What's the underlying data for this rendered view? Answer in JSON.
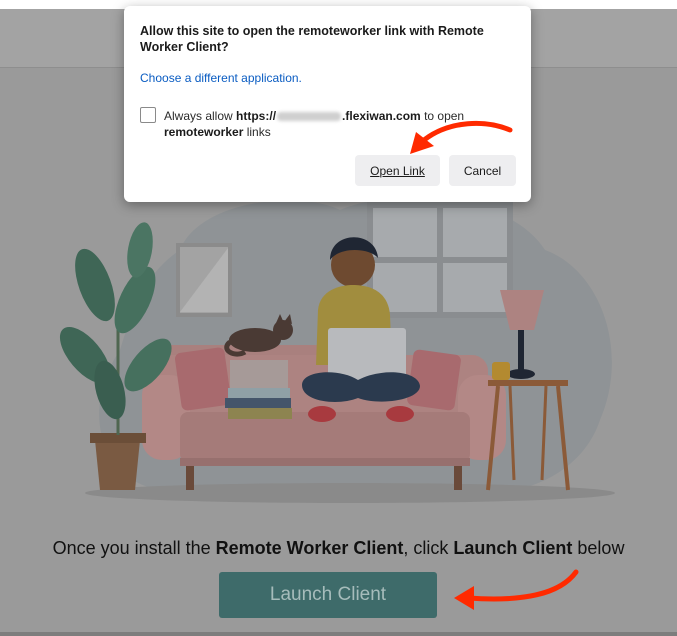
{
  "dialog": {
    "title": "Allow this site to open the remoteworker link with Remote Worker Client?",
    "choose_link": "Choose a different application.",
    "always_prefix": "Always allow ",
    "always_domain_start": "https://",
    "always_domain_end": ".flexiwan.com",
    "always_middle": " to open ",
    "always_scheme": "remoteworker",
    "always_suffix": " links",
    "open_label": "Open Link",
    "cancel_label": "Cancel"
  },
  "page": {
    "instruction_prefix": "Once you install the ",
    "instruction_app": "Remote Worker Client",
    "instruction_middle": ", click ",
    "instruction_action": "Launch Client",
    "instruction_suffix": " below",
    "launch_label": "Launch Client"
  },
  "colors": {
    "overlay": "#9a9a9a",
    "launch_button": "#3e6b6a",
    "link": "#0a5cc2",
    "annotation_arrow": "#ff2a00"
  },
  "icons": {
    "checkbox": "checkbox-unchecked-icon",
    "arrow": "annotation-arrow-icon"
  }
}
